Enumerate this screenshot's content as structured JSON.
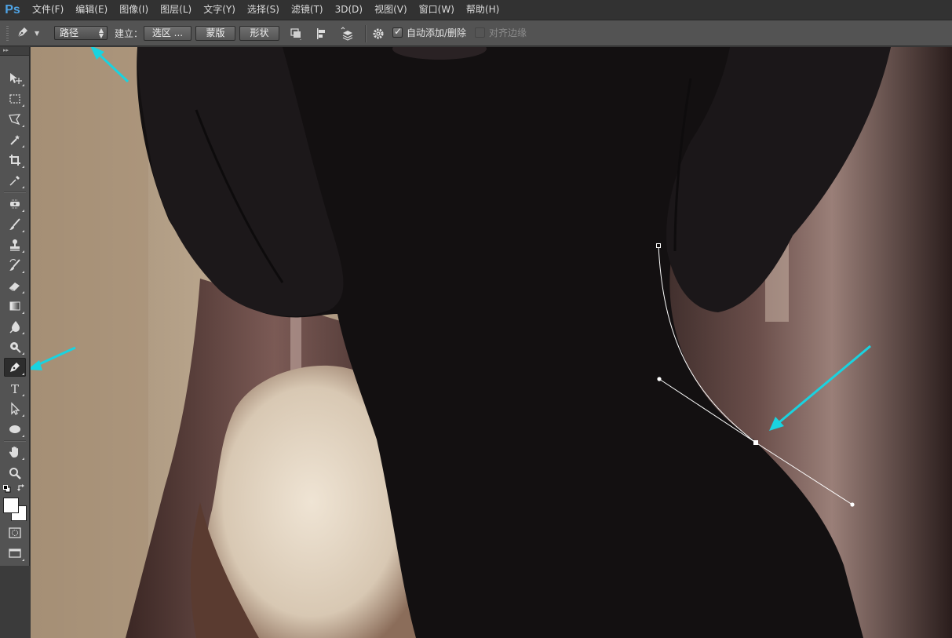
{
  "app": {
    "logo": "Ps"
  },
  "menu": [
    "文件(F)",
    "编辑(E)",
    "图像(I)",
    "图层(L)",
    "文字(Y)",
    "选择(S)",
    "滤镜(T)",
    "3D(D)",
    "视图(V)",
    "窗口(W)",
    "帮助(H)"
  ],
  "options": {
    "tool_icon": "pen-icon",
    "mode_value": "路径",
    "build_label": "建立：",
    "selection_button": "选区 ...",
    "mask_button": "蒙版",
    "shape_button": "形状",
    "path_operations_icon": "path-operations-icon",
    "path_alignment_icon": "path-alignment-icon",
    "path_arrangement_icon": "path-arrangement-icon",
    "settings_icon": "gear-icon",
    "auto_add_delete_label": "自动添加/删除",
    "auto_add_delete_checked": true,
    "align_edges_label": "对齐边缘",
    "align_edges_checked": false
  },
  "toolbox": {
    "tools": [
      "move-tool",
      "rectangular-marquee-tool",
      "polygonal-lasso-tool",
      "magic-wand-tool",
      "crop-tool",
      "eyedropper-tool",
      "spot-healing-brush-tool",
      "brush-tool",
      "clone-stamp-tool",
      "history-brush-tool",
      "eraser-tool",
      "gradient-tool",
      "blur-tool",
      "dodge-tool",
      "pen-tool",
      "type-tool",
      "path-selection-tool",
      "ellipse-tool",
      "hand-tool",
      "zoom-tool"
    ],
    "active_tool": "pen-tool",
    "foreground_color": "#ffffff",
    "background_color": "#ffffff"
  },
  "annotations": {
    "arrow_color": "#19d3e0",
    "count": 3
  },
  "colors": {
    "ui_panel": "#535353",
    "menubar": "#323232",
    "accent_logo": "#4fa4e6"
  }
}
